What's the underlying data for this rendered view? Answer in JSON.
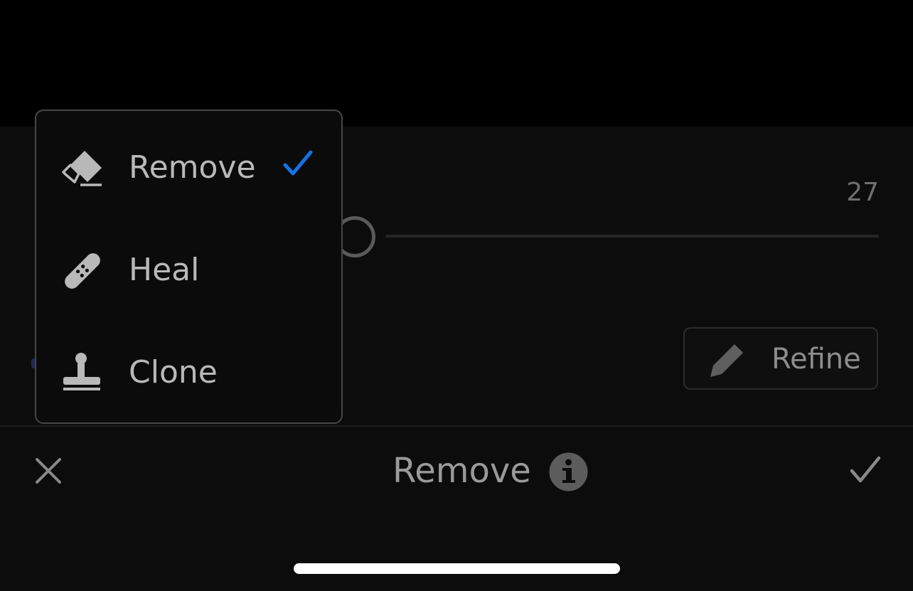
{
  "tool_panel": {
    "size_value": "27",
    "slider_level": 0.0,
    "refine_label": "Refine",
    "refine_icon": "pencil-icon"
  },
  "menu": {
    "items": [
      {
        "label": "Remove",
        "icon": "eraser-icon",
        "selected": true
      },
      {
        "label": "Heal",
        "icon": "bandage-icon",
        "selected": false
      },
      {
        "label": "Clone",
        "icon": "stamp-icon",
        "selected": false
      }
    ],
    "check_color": "#1473e6"
  },
  "bottom_bar": {
    "title": "Remove",
    "cancel_icon": "close-icon",
    "info_icon": "info-icon",
    "confirm_icon": "checkmark-icon"
  }
}
